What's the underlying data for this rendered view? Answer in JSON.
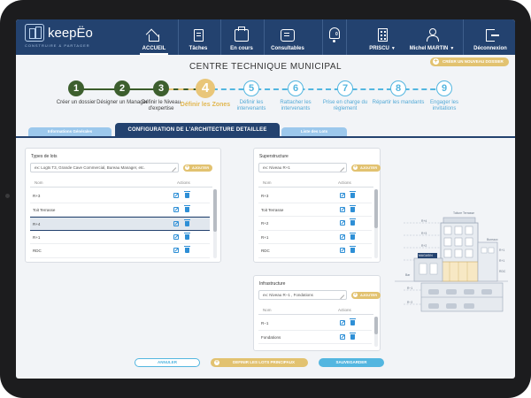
{
  "brand": {
    "name": "keepЁo",
    "tagline": "CONSTRUIRE & PARTAGER"
  },
  "nav": {
    "items": [
      {
        "label": "ACCUEIL",
        "icon": "home-icon",
        "active": true
      },
      {
        "label": "Tâches",
        "icon": "tasks-icon"
      },
      {
        "label": "En cours",
        "icon": "in-progress-icon"
      },
      {
        "label": "Consultables",
        "icon": "viewable-icon"
      }
    ],
    "notifications": {
      "count": "0",
      "icon": "bell-icon"
    },
    "site": {
      "label": "PRISCU",
      "icon": "building-icon"
    },
    "user": {
      "label": "Michel MARTIN",
      "icon": "user-icon"
    },
    "logout": {
      "label": "Déconnexion",
      "icon": "logout-icon"
    }
  },
  "page": {
    "title": "CENTRE TECHNIQUE MUNICIPAL",
    "create_button": "CRÉER UN NOUVEAU DOSSIER"
  },
  "steps": [
    {
      "num": "1",
      "label": "Créer un dossier",
      "state": "done"
    },
    {
      "num": "2",
      "label": "Désigner un Manager",
      "state": "done"
    },
    {
      "num": "3",
      "label": "Définir le Niveau d'expertise",
      "state": "done"
    },
    {
      "num": "4",
      "label": "Définir les Zones",
      "state": "current"
    },
    {
      "num": "5",
      "label": "Définir les intervenants",
      "state": "todo"
    },
    {
      "num": "6",
      "label": "Rattacher les intervenants",
      "state": "todo"
    },
    {
      "num": "7",
      "label": "Prise en charge du règlement",
      "state": "todo"
    },
    {
      "num": "8",
      "label": "Répartir les mandants",
      "state": "todo"
    },
    {
      "num": "9",
      "label": "Engager les invitations",
      "state": "todo"
    }
  ],
  "tabs": {
    "info": "Informations Générales",
    "config": "CONFIGURATION DE L'ARCHITECTURE DETAILLEE",
    "lots": "Liste des Lots"
  },
  "types_lots": {
    "title": "Types de lots",
    "input_value": "ex: Logts T3, Grande Cave Commercial, Bureau Manager, etc.",
    "add_label": "AJOUTER",
    "col_name": "Nom",
    "col_actions": "Actions",
    "rows": [
      "R+3",
      "Toit Terrasse",
      "R+4",
      "R+1",
      "RDC"
    ],
    "selected_index": 2
  },
  "superstructure": {
    "title": "Superstructure",
    "input_value": "ex: Niveau R+1",
    "add_label": "AJOUTER",
    "col_name": "Nom",
    "col_actions": "Actions",
    "rows": [
      "R+3",
      "Toit Terrasse",
      "R+2",
      "R+1",
      "RDC"
    ]
  },
  "infrastructure": {
    "title": "Infrastructure",
    "input_value": "ex: Niveau R−1 , Fondations",
    "add_label": "AJOUTER",
    "col_name": "Nom",
    "col_actions": "Actions",
    "rows": [
      "R−1",
      "Fondations"
    ]
  },
  "illustration": {
    "labels": [
      "Toiture Terrasse",
      "R+4",
      "R+3",
      "R+2",
      "R+1",
      "RDC",
      "R−1",
      "R−2",
      "Bureaux",
      "Bar",
      "MAGASIN"
    ]
  },
  "footer": {
    "cancel": "ANNULER",
    "define_lots": "DEFINIR LES LOTS PRINCIPAUX",
    "save": "SAUVEGARDER"
  },
  "colors": {
    "navy": "#23426f",
    "done": "#3d5f2e",
    "current": "#e9c679",
    "todo": "#53b6e0",
    "accent": "#e2c270"
  }
}
